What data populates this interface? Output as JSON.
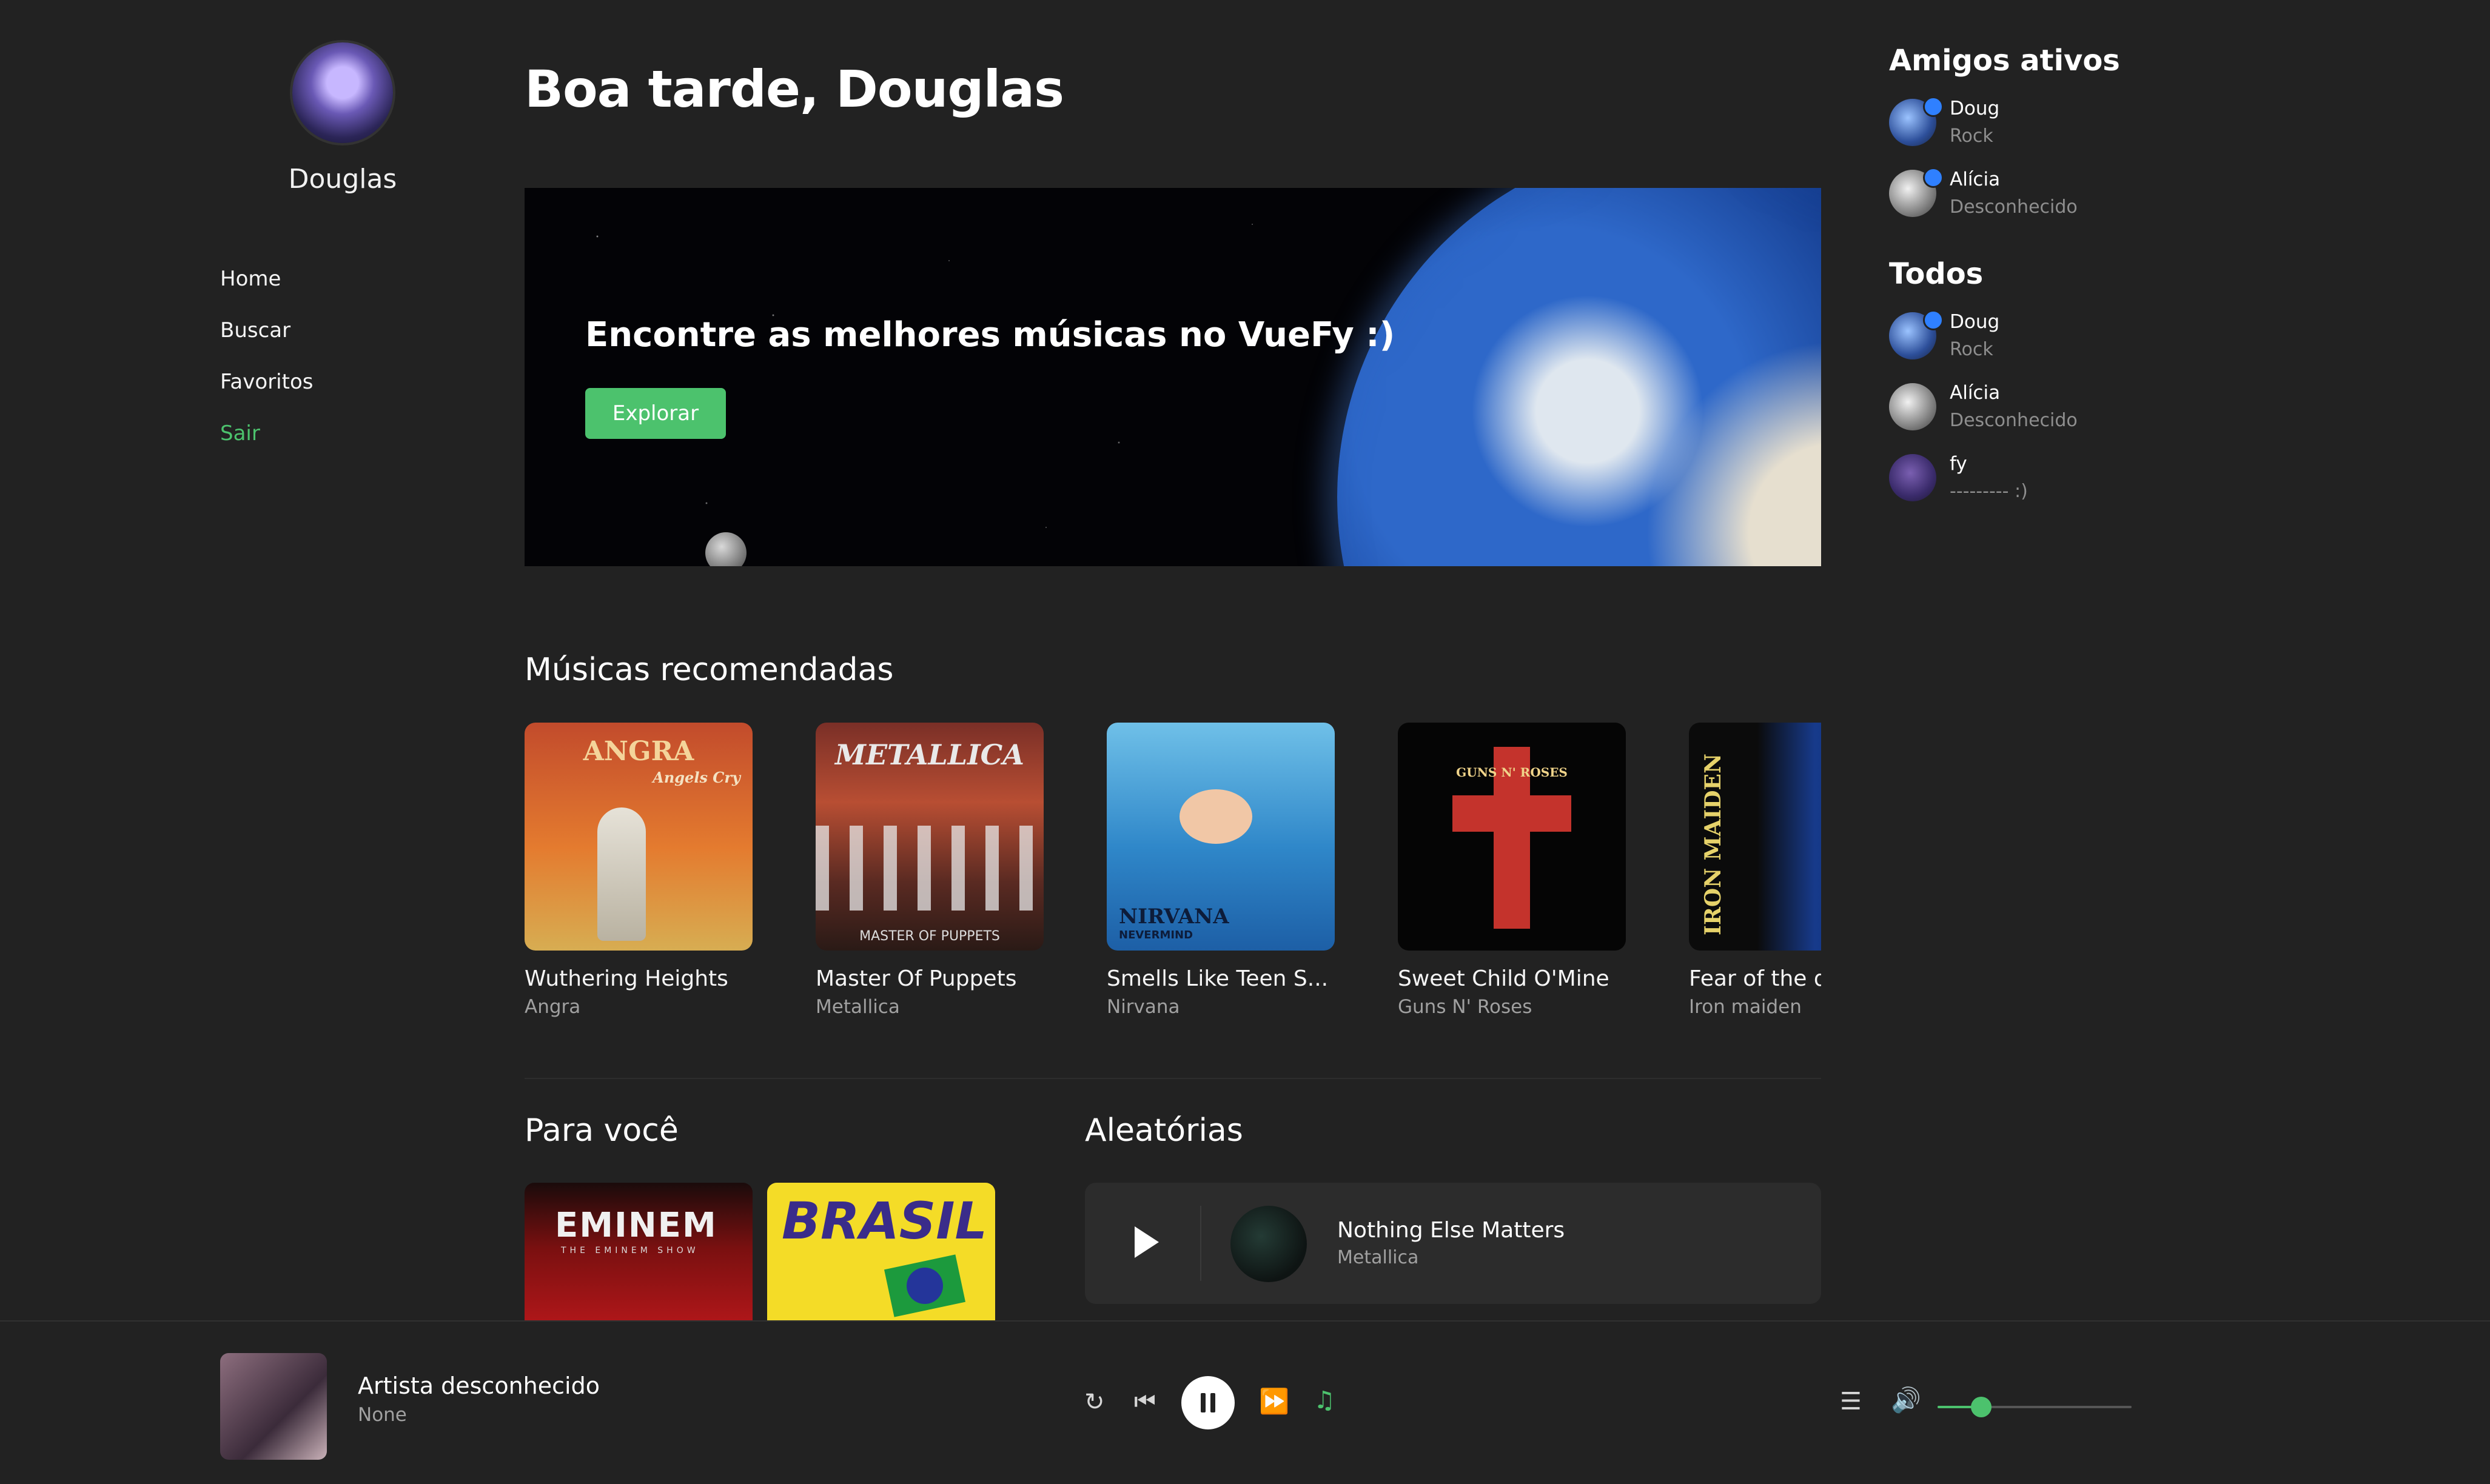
{
  "sidebar": {
    "username": "Douglas",
    "nav": [
      {
        "label": "Home"
      },
      {
        "label": "Buscar"
      },
      {
        "label": "Favoritos"
      },
      {
        "label": "Sair"
      }
    ]
  },
  "header": {
    "greeting": "Boa tarde, Douglas"
  },
  "banner": {
    "title": "Encontre as melhores músicas no VueFy :)",
    "button": "Explorar"
  },
  "recommended": {
    "title": "Músicas recomendadas",
    "items": [
      {
        "track": "Wuthering Heights",
        "artist": "Angra",
        "cover_text": "ANGRA",
        "cover_sub": "Angels Cry"
      },
      {
        "track": "Master Of Puppets",
        "artist": "Metallica",
        "cover_text": "METALLICA",
        "cover_sub": "MASTER OF PUPPETS"
      },
      {
        "track": "Smells Like Teen S...",
        "artist": "Nirvana",
        "cover_text": "NIRVANA",
        "cover_sub": "NEVERMIND"
      },
      {
        "track": "Sweet Child O'Mine",
        "artist": "Guns N' Roses",
        "cover_text": "GUNS N' ROSES",
        "cover_sub": ""
      },
      {
        "track": "Fear of the d",
        "artist": "Iron maiden",
        "cover_text": "IRON MAIDEN",
        "cover_sub": ""
      }
    ]
  },
  "para_voce": {
    "title": "Para você",
    "items": [
      {
        "cover_text": "EMINEM",
        "cover_sub": "THE EMINEM SHOW"
      },
      {
        "cover_text": "BRASIL",
        "cover_sub": ""
      }
    ]
  },
  "aleatorias": {
    "title": "Aleatórias",
    "track": "Nothing Else Matters",
    "artist": "Metallica"
  },
  "friends": {
    "active_title": "Amigos ativos",
    "active": [
      {
        "name": "Doug",
        "status": "Rock"
      },
      {
        "name": "Alícia",
        "status": "Desconhecido"
      }
    ],
    "all_title": "Todos",
    "all": [
      {
        "name": "Doug",
        "status": "Rock"
      },
      {
        "name": "Alícia",
        "status": "Desconhecido"
      },
      {
        "name": "fy",
        "status": "--------- :)"
      }
    ]
  },
  "player": {
    "title": "Artista desconhecido",
    "artist": "None",
    "volume": 0.2,
    "colors": {
      "accent": "#4cc26d"
    }
  }
}
